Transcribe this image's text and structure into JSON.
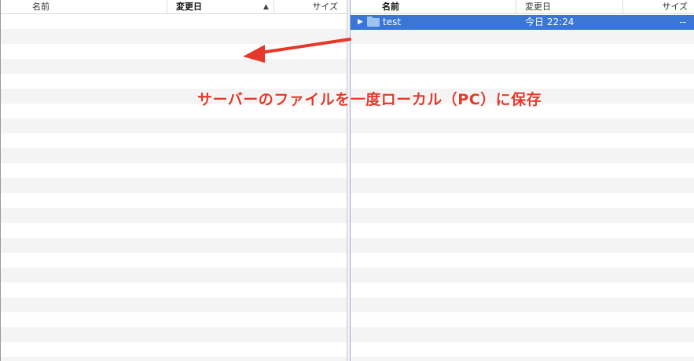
{
  "local_pane": {
    "columns": {
      "name": "名前",
      "modified": "変更日",
      "size": "サイズ"
    }
  },
  "remote_pane": {
    "columns": {
      "name": "名前",
      "modified": "変更日",
      "size": "サイズ"
    },
    "files": [
      {
        "name": "test",
        "modified": "今日 22:24",
        "size": "--",
        "icon": "folder-icon",
        "selected": true
      }
    ]
  },
  "annotation": {
    "text": "サーバーのファイルを一度ローカル（PC）に保存",
    "color": "#e5382a"
  },
  "colors": {
    "selection": "#3a76d4",
    "folder": "#9dc3f0",
    "stripe": "#f4f4f4"
  }
}
